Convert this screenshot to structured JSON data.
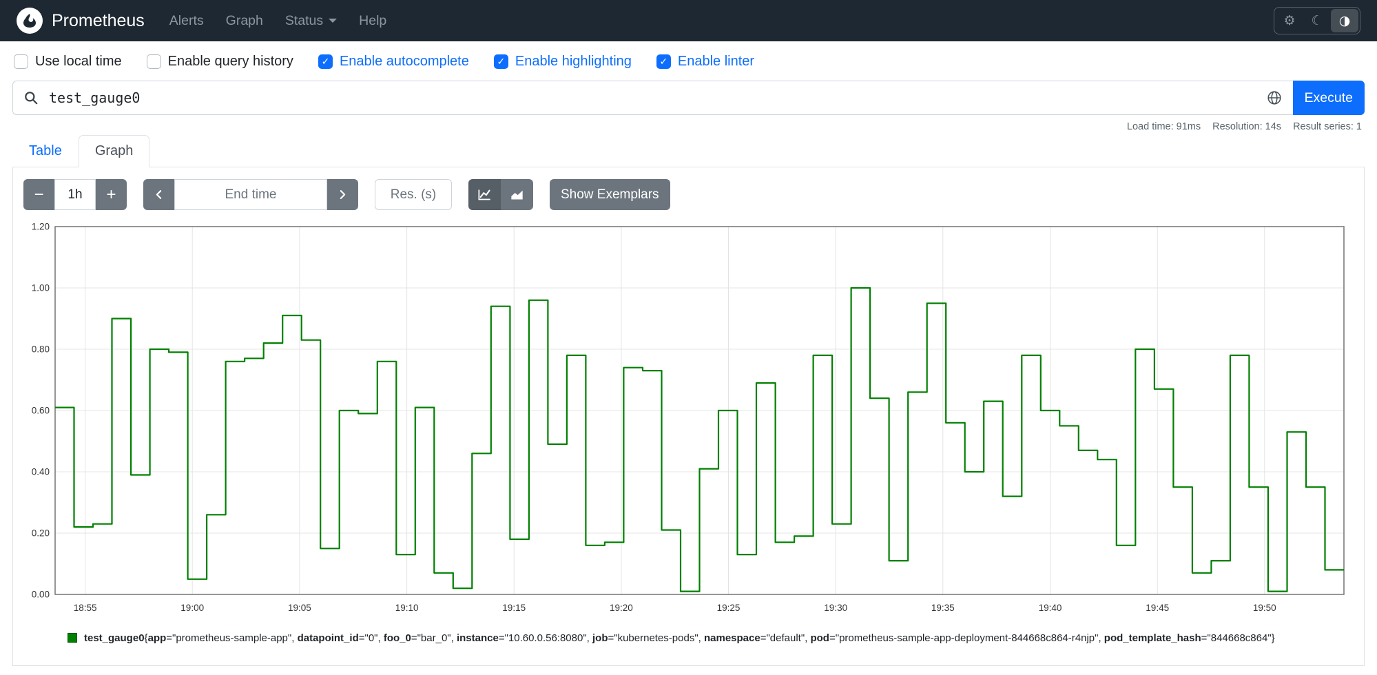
{
  "colors": {
    "navbar_bg": "#1e2832",
    "accent": "#0d6efd",
    "series_green": "#008000",
    "button_secondary": "#6c757d",
    "grid": "#e4e4e4",
    "plot_border": "#737373"
  },
  "navbar": {
    "brand": "Prometheus",
    "items": [
      {
        "label": "Alerts"
      },
      {
        "label": "Graph"
      },
      {
        "label": "Status",
        "has_caret": true
      },
      {
        "label": "Help"
      }
    ],
    "theme_buttons": [
      {
        "icon": "gear-icon"
      },
      {
        "icon": "moon-icon"
      },
      {
        "icon": "auto-theme-half-circle-icon",
        "active": true
      }
    ]
  },
  "options": {
    "checkboxes": [
      {
        "label": "Use local time",
        "checked": false
      },
      {
        "label": "Enable query history",
        "checked": false
      },
      {
        "label": "Enable autocomplete",
        "checked": true
      },
      {
        "label": "Enable highlighting",
        "checked": true
      },
      {
        "label": "Enable linter",
        "checked": true
      }
    ]
  },
  "query": {
    "value": "test_gauge0",
    "execute_label": "Execute"
  },
  "stats": {
    "load_time": "Load time: 91ms",
    "resolution": "Resolution: 14s",
    "result_series": "Result series: 1"
  },
  "tabs": [
    {
      "label": "Table",
      "active": false
    },
    {
      "label": "Graph",
      "active": true
    }
  ],
  "toolbar": {
    "range_value": "1h",
    "end_time_placeholder": "End time",
    "res_placeholder": "Res. (s)",
    "show_exemplars_label": "Show Exemplars"
  },
  "chart_data": {
    "type": "line",
    "title": "",
    "xlabel": "",
    "ylabel": "",
    "ylim": [
      0,
      1.2
    ],
    "y_ticks": [
      "0.00",
      "0.20",
      "0.40",
      "0.60",
      "0.80",
      "1.00",
      "1.20"
    ],
    "x_start_min": 1133.6,
    "x_end_min": 1193.7,
    "x_ticks": [
      {
        "min": 1135,
        "label": "18:55"
      },
      {
        "min": 1140,
        "label": "19:00"
      },
      {
        "min": 1145,
        "label": "19:05"
      },
      {
        "min": 1150,
        "label": "19:10"
      },
      {
        "min": 1155,
        "label": "19:15"
      },
      {
        "min": 1160,
        "label": "19:20"
      },
      {
        "min": 1165,
        "label": "19:25"
      },
      {
        "min": 1170,
        "label": "19:30"
      },
      {
        "min": 1175,
        "label": "19:35"
      },
      {
        "min": 1180,
        "label": "19:40"
      },
      {
        "min": 1185,
        "label": "19:45"
      },
      {
        "min": 1190,
        "label": "19:50"
      }
    ],
    "grid": true,
    "legend_position": "bottom",
    "series": [
      {
        "name": "test_gauge0{app=\"prometheus-sample-app\", datapoint_id=\"0\", foo_0=\"bar_0\", instance=\"10.60.0.56:8080\", job=\"kubernetes-pods\", namespace=\"default\", pod=\"prometheus-sample-app-deployment-844668c864-r4njp\", pod_template_hash=\"844668c864\"}",
        "color": "#008000",
        "values": [
          0.61,
          0.22,
          0.23,
          0.9,
          0.39,
          0.8,
          0.79,
          0.05,
          0.26,
          0.76,
          0.77,
          0.82,
          0.91,
          0.83,
          0.15,
          0.6,
          0.59,
          0.76,
          0.13,
          0.61,
          0.07,
          0.02,
          0.46,
          0.94,
          0.18,
          0.96,
          0.49,
          0.78,
          0.16,
          0.17,
          0.74,
          0.73,
          0.21,
          0.01,
          0.41,
          0.6,
          0.13,
          0.69,
          0.17,
          0.19,
          0.78,
          0.23,
          1.0,
          0.64,
          0.11,
          0.66,
          0.95,
          0.56,
          0.4,
          0.63,
          0.32,
          0.78,
          0.6,
          0.55,
          0.47,
          0.44,
          0.16,
          0.8,
          0.67,
          0.35,
          0.07,
          0.11,
          0.78,
          0.35,
          0.01,
          0.53,
          0.35,
          0.08
        ]
      }
    ]
  },
  "legend": {
    "metric": "test_gauge0",
    "labels": [
      {
        "key": "app",
        "value": "prometheus-sample-app"
      },
      {
        "key": "datapoint_id",
        "value": "0"
      },
      {
        "key": "foo_0",
        "value": "bar_0"
      },
      {
        "key": "instance",
        "value": "10.60.0.56:8080"
      },
      {
        "key": "job",
        "value": "kubernetes-pods"
      },
      {
        "key": "namespace",
        "value": "default"
      },
      {
        "key": "pod",
        "value": "prometheus-sample-app-deployment-844668c864-r4njp"
      },
      {
        "key": "pod_template_hash",
        "value": "844668c864"
      }
    ]
  }
}
